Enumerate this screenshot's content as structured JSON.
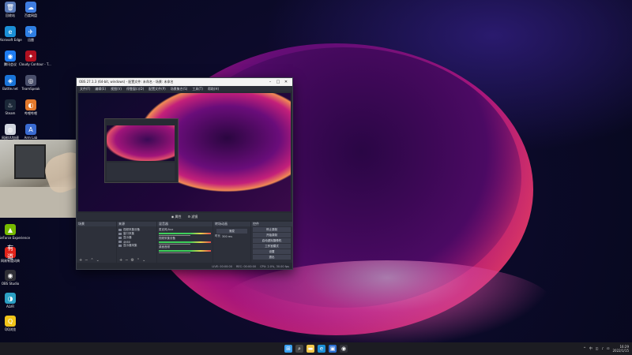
{
  "desktop": {
    "icons": [
      {
        "label": "回收站",
        "glyph": "🗑",
        "color": "#5a7bb8"
      },
      {
        "label": "百度网盘",
        "glyph": "☁",
        "color": "#3f7de0"
      },
      {
        "label": "Microsoft Edge",
        "glyph": "e",
        "color": "#1b8fd6"
      },
      {
        "label": "迅雷",
        "glyph": "✈",
        "color": "#2f7fe3"
      },
      {
        "label": "腾讯会议",
        "glyph": "◉",
        "color": "#1e7cf2"
      },
      {
        "label": "Cloudy Contour - T...",
        "glyph": "✦",
        "color": "#b01020"
      },
      {
        "label": "Battle.net",
        "glyph": "◈",
        "color": "#1a74d8"
      },
      {
        "label": "TeamSpeak",
        "glyph": "◎",
        "color": "#4a4f6b"
      },
      {
        "label": "Steam",
        "glyph": "♨",
        "color": "#1b2838"
      },
      {
        "label": "哔哩哔哩",
        "glyph": "◐",
        "color": "#e3792c"
      },
      {
        "label": "网易UU加速",
        "glyph": "◍",
        "color": "#d0d4de"
      },
      {
        "label": "Arm Lab",
        "glyph": "A",
        "color": "#3a6bd1"
      },
      {
        "label": "GeForce Experience",
        "glyph": "▲",
        "color": "#76b900"
      },
      {
        "label": "网易有道词典",
        "glyph": "有道",
        "color": "#e2231a"
      },
      {
        "label": "OBS Studio",
        "glyph": "◉",
        "color": "#2f2f36"
      },
      {
        "label": "ALVR",
        "glyph": "◑",
        "color": "#2ca0c4"
      },
      {
        "label": "QQ浏览",
        "glyph": "Q",
        "color": "#f0c419"
      }
    ]
  },
  "obs": {
    "title": "OBS 27.1.3 (64-bit, windows) - 配置文件: 未命名 - 场景: 未命名",
    "menu": [
      "文件(F)",
      "编辑(E)",
      "视图(V)",
      "停靠窗口(D)",
      "配置文件(P)",
      "场景集合(S)",
      "工具(T)",
      "帮助(H)"
    ],
    "controls_bar": [
      "◉ 属性",
      "⚙ 滤镜"
    ],
    "docks": {
      "scenes": {
        "title": "场景"
      },
      "sources": {
        "title": "来源",
        "items": [
          "视频采集设备",
          "窗口采集",
          "显示器",
          "4K60",
          "显示器采集"
        ]
      },
      "mixer": {
        "title": "混音器",
        "tracks": [
          {
            "name": "麦克风/Aux"
          },
          {
            "name": "视频采集设备"
          },
          {
            "name": "桌面音频"
          }
        ]
      },
      "transitions": {
        "title": "转场动画",
        "type": "渐变",
        "duration_label": "时长",
        "duration": "300 ms"
      },
      "controls": {
        "title": "控件",
        "buttons": [
          "停止录制",
          "开始录制",
          "启动虚拟摄像机",
          "工作室模式",
          "设置",
          "退出"
        ]
      }
    },
    "status": [
      "LIVE: 00:00:00",
      "REC: 00:00:00",
      "CPU: 2.0%, 30.00 fps"
    ]
  },
  "taskbar": {
    "apps": [
      {
        "name": "start",
        "glyph": "⊞",
        "color": "#3aa0f0"
      },
      {
        "name": "search",
        "glyph": "⌕",
        "color": "#444"
      },
      {
        "name": "explorer",
        "glyph": "▬",
        "color": "#f2c94c"
      },
      {
        "name": "edge",
        "glyph": "e",
        "color": "#1b8fd6"
      },
      {
        "name": "store",
        "glyph": "▣",
        "color": "#2d6fd0"
      },
      {
        "name": "obs",
        "glyph": "◉",
        "color": "#2f2f36"
      }
    ],
    "tray": [
      "^",
      "中",
      "◫",
      "♪",
      "⊡"
    ],
    "time": "16:29",
    "date": "2022/1/15"
  }
}
